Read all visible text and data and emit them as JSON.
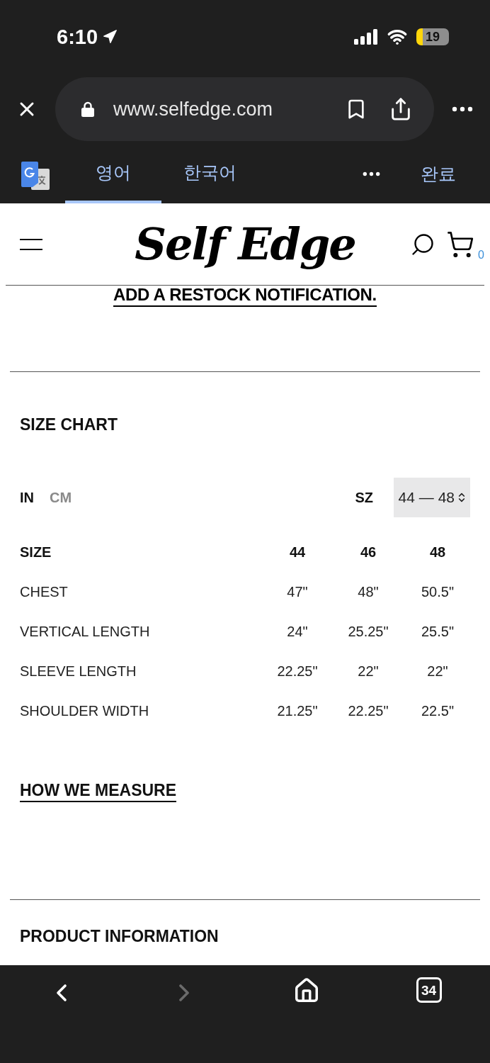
{
  "status_bar": {
    "time": "6:10",
    "battery": "19"
  },
  "browser": {
    "url": "www.selfedge.com"
  },
  "translate_bar": {
    "languages": [
      {
        "label": "영어",
        "selected": true
      },
      {
        "label": "한국어",
        "selected": false
      }
    ],
    "done": "완료"
  },
  "site_header": {
    "logo": "Self Edge",
    "cart_count": "0"
  },
  "restock_link": "ADD A RESTOCK NOTIFICATION.",
  "size_chart": {
    "title": "SIZE CHART",
    "units": [
      {
        "label": "IN",
        "selected": true
      },
      {
        "label": "CM",
        "selected": false
      }
    ],
    "size_label": "SZ",
    "size_range": "44 — 48",
    "columns": [
      "SIZE",
      "44",
      "46",
      "48"
    ],
    "rows": [
      {
        "label": "CHEST",
        "values": [
          "47\"",
          "48\"",
          "50.5\""
        ]
      },
      {
        "label": "VERTICAL LENGTH",
        "values": [
          "24\"",
          "25.25\"",
          "25.5\""
        ]
      },
      {
        "label": "SLEEVE LENGTH",
        "values": [
          "22.25\"",
          "22\"",
          "22\""
        ]
      },
      {
        "label": "SHOULDER WIDTH",
        "values": [
          "21.25\"",
          "22.25\"",
          "22.5\""
        ]
      }
    ]
  },
  "how_we_measure": "HOW WE MEASURE",
  "product_information": "PRODUCT INFORMATION",
  "bottom_toolbar": {
    "buttons": [
      {
        "kind": "back",
        "disabled": false
      },
      {
        "kind": "forward",
        "disabled": true
      },
      {
        "kind": "home",
        "disabled": false
      },
      {
        "kind": "tabs",
        "label": "34",
        "disabled": false
      }
    ]
  }
}
